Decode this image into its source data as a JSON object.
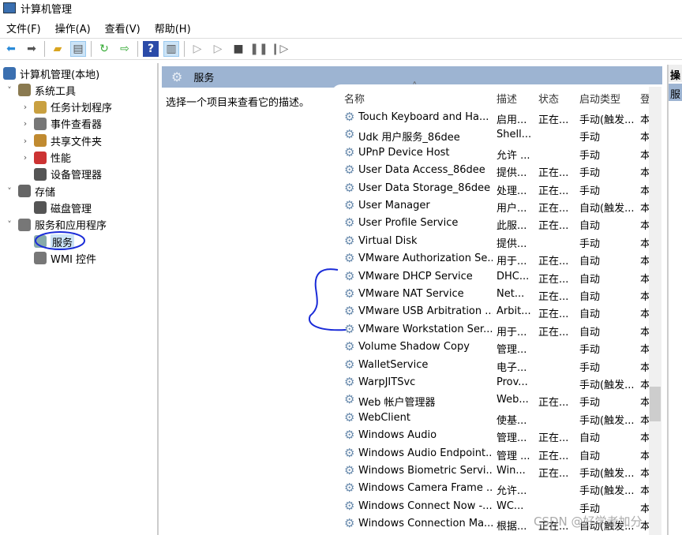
{
  "title": "计算机管理",
  "menu": [
    "文件(F)",
    "操作(A)",
    "查看(V)",
    "帮助(H)"
  ],
  "toolbar": [
    "back-icon",
    "forward-icon",
    "up-folder-icon",
    "show-hide-tree-icon",
    "refresh-icon",
    "export-icon",
    "help-icon",
    "show-action-pane-icon",
    "play-icon",
    "play-alt-icon",
    "stop-icon",
    "pause-icon",
    "restart-icon"
  ],
  "tree": [
    {
      "label": "计算机管理(本地)",
      "level": 0,
      "chev": ""
    },
    {
      "label": "系统工具",
      "level": 1,
      "chev": "˅"
    },
    {
      "label": "任务计划程序",
      "level": 2,
      "chev": "›"
    },
    {
      "label": "事件查看器",
      "level": 2,
      "chev": "›"
    },
    {
      "label": "共享文件夹",
      "level": 2,
      "chev": "›"
    },
    {
      "label": "性能",
      "level": 2,
      "chev": "›"
    },
    {
      "label": "设备管理器",
      "level": 2,
      "chev": ""
    },
    {
      "label": "存储",
      "level": 1,
      "chev": "˅"
    },
    {
      "label": "磁盘管理",
      "level": 2,
      "chev": ""
    },
    {
      "label": "服务和应用程序",
      "level": 1,
      "chev": "˅"
    },
    {
      "label": "服务",
      "level": 2,
      "chev": "",
      "selected": true
    },
    {
      "label": "WMI 控件",
      "level": 2,
      "chev": ""
    }
  ],
  "pane": {
    "title": "服务",
    "description": "选择一个项目来查看它的描述。"
  },
  "columns": [
    "名称",
    "描述",
    "状态",
    "启动类型",
    "登"
  ],
  "services": [
    [
      "Touch Keyboard and Ha...",
      "启用...",
      "正在...",
      "手动(触发...",
      "本"
    ],
    [
      "Udk 用户服务_86dee",
      "Shell...",
      "",
      "手动",
      "本"
    ],
    [
      "UPnP Device Host",
      "允许 ...",
      "",
      "手动",
      "本"
    ],
    [
      "User Data Access_86dee",
      "提供...",
      "正在...",
      "手动",
      "本"
    ],
    [
      "User Data Storage_86dee",
      "处理...",
      "正在...",
      "手动",
      "本"
    ],
    [
      "User Manager",
      "用户...",
      "正在...",
      "自动(触发...",
      "本"
    ],
    [
      "User Profile Service",
      "此服...",
      "正在...",
      "自动",
      "本"
    ],
    [
      "Virtual Disk",
      "提供...",
      "",
      "手动",
      "本"
    ],
    [
      "VMware Authorization Se...",
      "用于...",
      "正在...",
      "自动",
      "本"
    ],
    [
      "VMware DHCP Service",
      "DHC...",
      "正在...",
      "自动",
      "本"
    ],
    [
      "VMware NAT Service",
      "Net...",
      "正在...",
      "自动",
      "本"
    ],
    [
      "VMware USB Arbitration ...",
      "Arbit...",
      "正在...",
      "自动",
      "本"
    ],
    [
      "VMware Workstation Ser...",
      "用于...",
      "正在...",
      "自动",
      "本"
    ],
    [
      "Volume Shadow Copy",
      "管理...",
      "",
      "手动",
      "本"
    ],
    [
      "WalletService",
      "电子...",
      "",
      "手动",
      "本"
    ],
    [
      "WarpJITSvc",
      "Prov...",
      "",
      "手动(触发...",
      "本"
    ],
    [
      "Web 帐户管理器",
      "Web...",
      "正在...",
      "手动",
      "本"
    ],
    [
      "WebClient",
      "使基...",
      "",
      "手动(触发...",
      "本"
    ],
    [
      "Windows Audio",
      "管理...",
      "正在...",
      "自动",
      "本"
    ],
    [
      "Windows Audio Endpoint...",
      "管理 ...",
      "正在...",
      "自动",
      "本"
    ],
    [
      "Windows Biometric Servi...",
      "Win...",
      "正在...",
      "手动(触发...",
      "本"
    ],
    [
      "Windows Camera Frame ...",
      "允许...",
      "",
      "手动(触发...",
      "本"
    ],
    [
      "Windows Connect Now -...",
      "WC...",
      "",
      "手动",
      "本"
    ],
    [
      "Windows Connection Ma...",
      "根据...",
      "正在...",
      "自动(触发...",
      "本"
    ]
  ],
  "actions": {
    "title": "操",
    "item": "服"
  },
  "watermark": "CSDN @好学者加分",
  "colors": {
    "header": "#9db4d2",
    "annotation": "#1a2bd8",
    "selection": "#cce4f7"
  }
}
